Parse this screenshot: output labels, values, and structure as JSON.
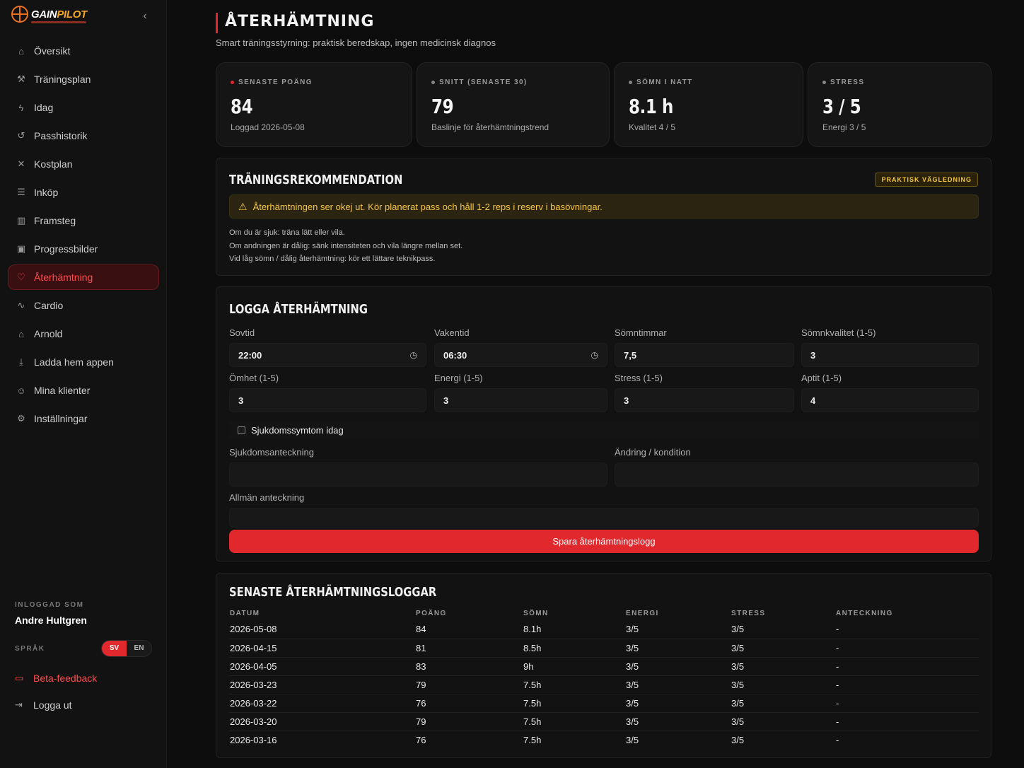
{
  "brand": {
    "name_a": "GAIN",
    "name_b": "PILOT"
  },
  "sidebar": {
    "collapse_icon": "chevron-left-icon",
    "items": [
      {
        "label": "Översikt",
        "icon": "home-icon",
        "glyph": "⌂",
        "active": false
      },
      {
        "label": "Träningsplan",
        "icon": "dumbbell-icon",
        "glyph": "⚒",
        "active": false
      },
      {
        "label": "Idag",
        "icon": "bolt-icon",
        "glyph": "ϟ",
        "active": false
      },
      {
        "label": "Passhistorik",
        "icon": "history-icon",
        "glyph": "↺",
        "active": false
      },
      {
        "label": "Kostplan",
        "icon": "utensils-icon",
        "glyph": "✕",
        "active": false
      },
      {
        "label": "Inköp",
        "icon": "list-icon",
        "glyph": "☰",
        "active": false
      },
      {
        "label": "Framsteg",
        "icon": "chart-icon",
        "glyph": "▥",
        "active": false
      },
      {
        "label": "Progressbilder",
        "icon": "images-icon",
        "glyph": "▣",
        "active": false
      },
      {
        "label": "Återhämtning",
        "icon": "heart-icon",
        "glyph": "♡",
        "active": true
      },
      {
        "label": "Cardio",
        "icon": "activity-icon",
        "glyph": "∿",
        "active": false
      },
      {
        "label": "Arnold",
        "icon": "lock-icon",
        "glyph": "⌂",
        "active": false
      },
      {
        "label": "Ladda hem appen",
        "icon": "download-icon",
        "glyph": "⤓",
        "active": false
      },
      {
        "label": "Mina klienter",
        "icon": "users-icon",
        "glyph": "☺",
        "active": false
      },
      {
        "label": "Inställningar",
        "icon": "gear-icon",
        "glyph": "⚙",
        "active": false
      }
    ],
    "logged_in_label": "INLOGGAD SOM",
    "user_name": "Andre Hultgren",
    "language_label": "SPRÅK",
    "lang_sv": "SV",
    "lang_en": "EN",
    "beta_feedback": "Beta-feedback",
    "logout": "Logga ut"
  },
  "page": {
    "title": "ÅTERHÄMTNING",
    "subtitle": "Smart träningsstyrning: praktisk beredskap, ingen medicinsk diagnos"
  },
  "stats": [
    {
      "label": "SENASTE POÄNG",
      "value": "84",
      "sub": "Loggad 2026-05-08"
    },
    {
      "label": "SNITT (SENASTE 30)",
      "value": "79",
      "sub": "Baslinje för återhämtningstrend"
    },
    {
      "label": "SÖMN I NATT",
      "value": "8.1 h",
      "sub": "Kvalitet 4 / 5"
    },
    {
      "label": "STRESS",
      "value": "3 / 5",
      "sub": "Energi 3 / 5"
    }
  ],
  "recommendation": {
    "title": "TRÄNINGSREKOMMENDATION",
    "badge": "PRAKTISK VÄGLEDNING",
    "alert": "Återhämtningen ser okej ut. Kör planerat pass och håll 1-2 reps i reserv i basövningar.",
    "tips": [
      "Om du är sjuk: träna lätt eller vila.",
      "Om andningen är dålig: sänk intensiteten och vila längre mellan set.",
      "Vid låg sömn / dålig återhämtning: kör ett lättare teknikpass."
    ]
  },
  "log_form": {
    "title": "LOGGA ÅTERHÄMTNING",
    "sovtid_label": "Sovtid",
    "sovtid_value": "22:00",
    "vakentid_label": "Vakentid",
    "vakentid_value": "06:30",
    "somntimmar_label": "Sömntimmar",
    "somntimmar_value": "7,5",
    "somnkvalitet_label": "Sömnkvalitet (1-5)",
    "somnkvalitet_value": "3",
    "omhet_label": "Ömhet (1-5)",
    "omhet_value": "3",
    "energi_label": "Energi (1-5)",
    "energi_value": "3",
    "stress_label": "Stress (1-5)",
    "stress_value": "3",
    "aptit_label": "Aptit (1-5)",
    "aptit_value": "4",
    "symptom_label": "Sjukdomssymtom idag",
    "sjuk_note_label": "Sjukdomsanteckning",
    "andring_label": "Ändring / kondition",
    "allman_label": "Allmän anteckning",
    "save_label": "Spara återhämtningslogg"
  },
  "history": {
    "title": "SENASTE ÅTERHÄMTNINGSLOGGAR",
    "columns": [
      "DATUM",
      "POÄNG",
      "SÖMN",
      "ENERGI",
      "STRESS",
      "ANTECKNING"
    ],
    "rows": [
      [
        "2026-05-08",
        "84",
        "8.1h",
        "3/5",
        "3/5",
        "-"
      ],
      [
        "2026-04-15",
        "81",
        "8.5h",
        "3/5",
        "3/5",
        "-"
      ],
      [
        "2026-04-05",
        "83",
        "9h",
        "3/5",
        "3/5",
        "-"
      ],
      [
        "2026-03-23",
        "79",
        "7.5h",
        "3/5",
        "3/5",
        "-"
      ],
      [
        "2026-03-22",
        "76",
        "7.5h",
        "3/5",
        "3/5",
        "-"
      ],
      [
        "2026-03-20",
        "79",
        "7.5h",
        "3/5",
        "3/5",
        "-"
      ],
      [
        "2026-03-16",
        "76",
        "7.5h",
        "3/5",
        "3/5",
        "-"
      ]
    ]
  }
}
